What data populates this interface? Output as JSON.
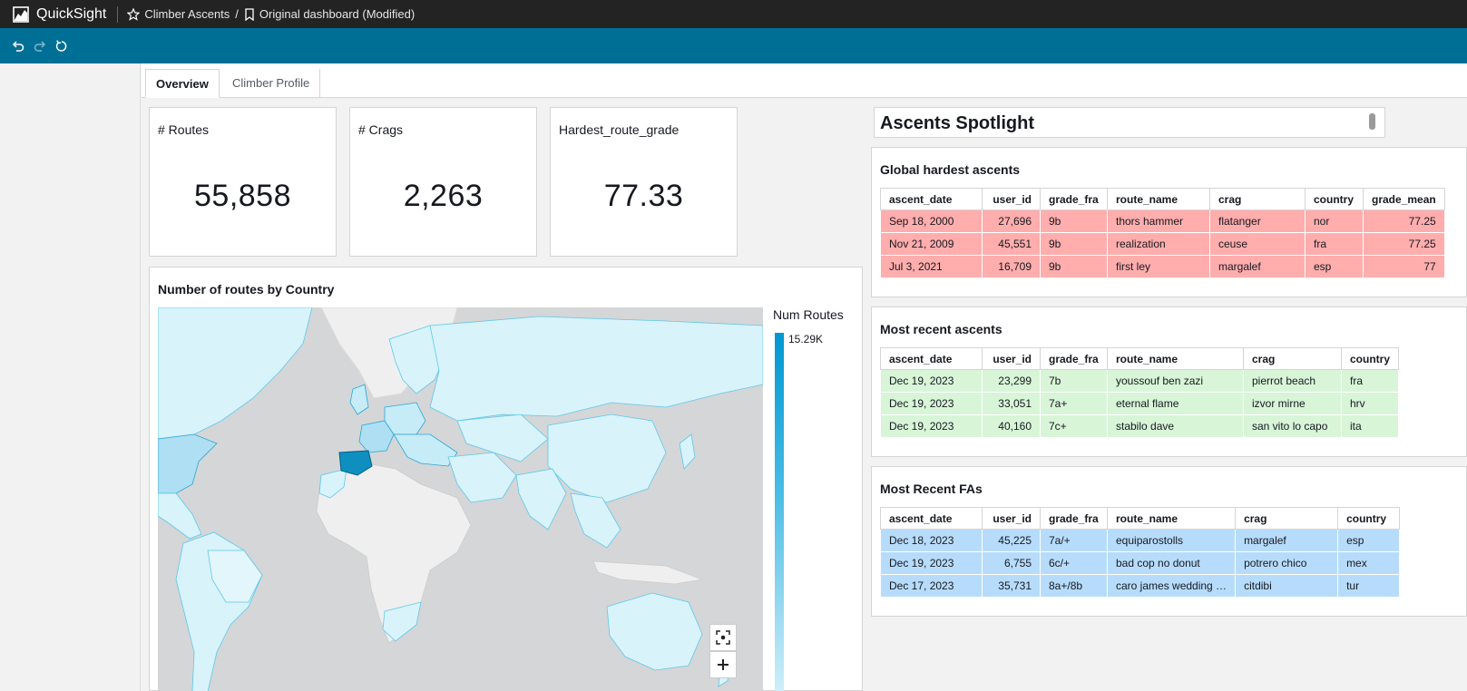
{
  "app": {
    "name": "QuickSight",
    "breadcrumb": {
      "analysis": "Climber Ascents",
      "separator": "/",
      "dashboard": "Original dashboard (Modified)"
    }
  },
  "colors": {
    "topbar": "#232323",
    "toolbar": "#006f96",
    "red_rows": "#ffadad",
    "green_rows": "#d8f5d8",
    "blue_rows": "#b7dcfb"
  },
  "toolbar": {
    "icons": [
      "undo-icon",
      "redo-icon",
      "reset-icon"
    ]
  },
  "tabs": [
    {
      "label": "Overview",
      "active": true
    },
    {
      "label": "Climber Profile",
      "active": false
    }
  ],
  "kpis": [
    {
      "title": "# Routes",
      "value": "55,858"
    },
    {
      "title": "# Crags",
      "value": "2,263"
    },
    {
      "title": "Hardest_route_grade",
      "value": "77.33"
    }
  ],
  "map": {
    "title": "Number of routes by Country",
    "legend_title": "Num Routes",
    "legend_max": "15.29K",
    "controls": [
      "focus-icon",
      "zoom-in-icon"
    ]
  },
  "spotlight": {
    "title": "Ascents Spotlight"
  },
  "tables": {
    "hardest": {
      "title": "Global hardest ascents",
      "columns": [
        "ascent_date",
        "user_id",
        "grade_fra",
        "route_name",
        "crag",
        "country",
        "grade_mean"
      ],
      "rows": [
        [
          "Sep 18, 2000",
          "27,696",
          "9b",
          "thors hammer",
          "flatanger",
          "nor",
          "77.25"
        ],
        [
          "Nov 21, 2009",
          "45,551",
          "9b",
          "realization",
          "ceuse",
          "fra",
          "77.25"
        ],
        [
          "Jul 3, 2021",
          "16,709",
          "9b",
          "first ley",
          "margalef",
          "esp",
          "77"
        ]
      ]
    },
    "recent": {
      "title": "Most recent ascents",
      "columns": [
        "ascent_date",
        "user_id",
        "grade_fra",
        "route_name",
        "crag",
        "country"
      ],
      "rows": [
        [
          "Dec 19, 2023",
          "23,299",
          "7b",
          "youssouf ben zazi",
          "pierrot beach",
          "fra"
        ],
        [
          "Dec 19, 2023",
          "33,051",
          "7a+",
          "eternal flame",
          "izvor mirne",
          "hrv"
        ],
        [
          "Dec 19, 2023",
          "40,160",
          "7c+",
          "stabilo dave",
          "san vito lo capo",
          "ita"
        ]
      ]
    },
    "fas": {
      "title": "Most Recent FAs",
      "columns": [
        "ascent_date",
        "user_id",
        "grade_fra",
        "route_name",
        "crag",
        "country"
      ],
      "rows": [
        [
          "Dec 18, 2023",
          "45,225",
          "7a/+",
          "equiparostolls",
          "margalef",
          "esp"
        ],
        [
          "Dec 19, 2023",
          "6,755",
          "6c/+",
          "bad cop no donut",
          "potrero chico",
          "mex"
        ],
        [
          "Dec 17, 2023",
          "35,731",
          "8a+/8b",
          "caro james wedding …",
          "citdibi",
          "tur"
        ]
      ]
    }
  }
}
